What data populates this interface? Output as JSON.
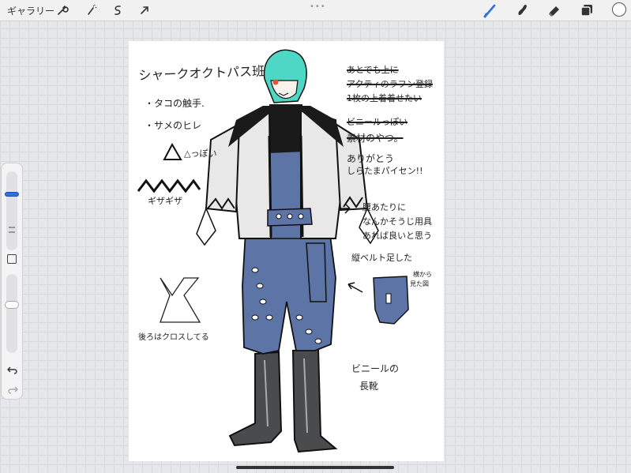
{
  "app": {
    "gallery_label": "ギャラリー",
    "toolbar_left": [
      {
        "name": "actions-wrench-icon"
      },
      {
        "name": "adjustments-wand-icon"
      },
      {
        "name": "selection-s-icon"
      },
      {
        "name": "transform-arrow-icon"
      }
    ],
    "toolbar_right": [
      {
        "name": "brush-icon"
      },
      {
        "name": "smudge-icon"
      },
      {
        "name": "eraser-icon"
      },
      {
        "name": "layers-icon"
      }
    ],
    "current_color": "#ffffff",
    "accent": "#2f6fde"
  },
  "sidebar": {
    "brush_size_level": 0.72,
    "opacity_level": 0.62
  },
  "artwork": {
    "title": "シャークオクトパス班",
    "bullets": [
      "・タコの触手.",
      "・サメのヒレ"
    ],
    "triangle_note": "△っぽい",
    "zigzag_label": "ギザギザ",
    "back_note": "後ろはクロスしてる",
    "top_right_strike_lines": [
      "あとでも上に",
      "アクティのラフン登録",
      "1枚の上着着せたい"
    ],
    "vinyl_strike": "ビニールっぽい",
    "material_strike": "素材のやつ。",
    "thanks": [
      "ありがとう",
      "しらたまパイセン!!"
    ],
    "waist_note": [
      "腰あたりに",
      "なんかそうじ用具",
      "あれば良いと思う"
    ],
    "belt_note": "縦ベルト足した",
    "side_view_note": [
      "横から",
      "見た図"
    ],
    "boots_note": [
      "ビニールの",
      "長靴"
    ]
  }
}
